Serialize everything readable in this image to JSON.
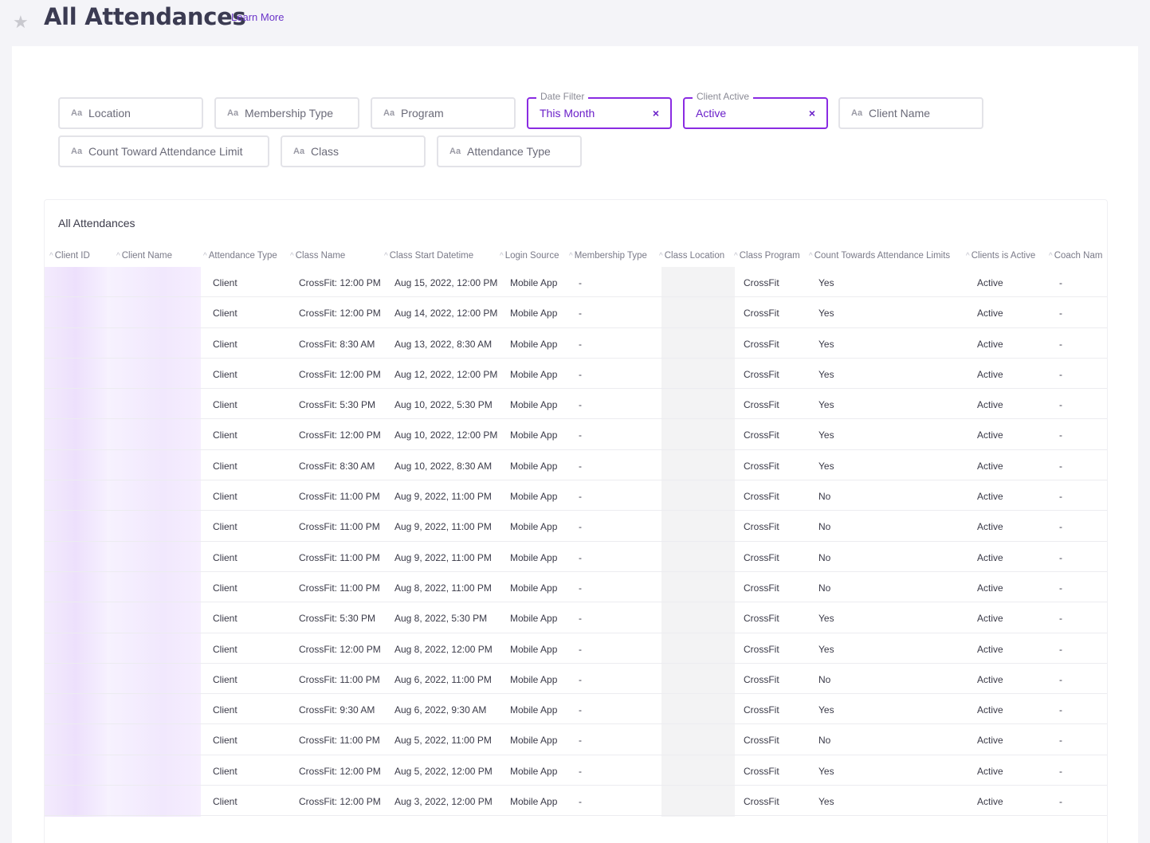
{
  "header": {
    "title": "All Attendances",
    "learn_more": "Learn More",
    "star_icon": "star-icon"
  },
  "filters": {
    "aa_glyph": "Aa",
    "location": "Location",
    "membership_type": "Membership Type",
    "program": "Program",
    "date_filter": {
      "legend": "Date Filter",
      "value": "This Month",
      "clear": "×"
    },
    "client_active": {
      "legend": "Client Active",
      "value": "Active",
      "clear": "×"
    },
    "client_name": "Client Name",
    "count_toward": "Count Toward Attendance Limit",
    "class": "Class",
    "attendance_type": "Attendance Type"
  },
  "table": {
    "title": "All Attendances",
    "caret": "^",
    "columns": [
      "Client ID",
      "Client Name",
      "Attendance Type",
      "Class Name",
      "Class Start Datetime",
      "Login Source",
      "Membership Type",
      "Class Location",
      "Class Program",
      "Count Towards Attendance Limits",
      "Clients is Active",
      "Coach Nam"
    ],
    "rows": [
      {
        "type": "Client",
        "class": "CrossFit: 12:00 PM",
        "start": "Aug 15, 2022, 12:00 PM",
        "source": "Mobile App",
        "membership": "-",
        "program": "CrossFit",
        "counts": "Yes",
        "active": "Active",
        "coach": "-"
      },
      {
        "type": "Client",
        "class": "CrossFit: 12:00 PM",
        "start": "Aug 14, 2022, 12:00 PM",
        "source": "Mobile App",
        "membership": "-",
        "program": "CrossFit",
        "counts": "Yes",
        "active": "Active",
        "coach": "-"
      },
      {
        "type": "Client",
        "class": "CrossFit: 8:30 AM",
        "start": "Aug 13, 2022, 8:30 AM",
        "source": "Mobile App",
        "membership": "-",
        "program": "CrossFit",
        "counts": "Yes",
        "active": "Active",
        "coach": "-"
      },
      {
        "type": "Client",
        "class": "CrossFit: 12:00 PM",
        "start": "Aug 12, 2022, 12:00 PM",
        "source": "Mobile App",
        "membership": "-",
        "program": "CrossFit",
        "counts": "Yes",
        "active": "Active",
        "coach": "-"
      },
      {
        "type": "Client",
        "class": "CrossFit: 5:30 PM",
        "start": "Aug 10, 2022, 5:30 PM",
        "source": "Mobile App",
        "membership": "-",
        "program": "CrossFit",
        "counts": "Yes",
        "active": "Active",
        "coach": "-"
      },
      {
        "type": "Client",
        "class": "CrossFit: 12:00 PM",
        "start": "Aug 10, 2022, 12:00 PM",
        "source": "Mobile App",
        "membership": "-",
        "program": "CrossFit",
        "counts": "Yes",
        "active": "Active",
        "coach": "-"
      },
      {
        "type": "Client",
        "class": "CrossFit: 8:30 AM",
        "start": "Aug 10, 2022, 8:30 AM",
        "source": "Mobile App",
        "membership": "-",
        "program": "CrossFit",
        "counts": "Yes",
        "active": "Active",
        "coach": "-"
      },
      {
        "type": "Client",
        "class": "CrossFit: 11:00 PM",
        "start": "Aug 9, 2022, 11:00 PM",
        "source": "Mobile App",
        "membership": "-",
        "program": "CrossFit",
        "counts": "No",
        "active": "Active",
        "coach": "-"
      },
      {
        "type": "Client",
        "class": "CrossFit: 11:00 PM",
        "start": "Aug 9, 2022, 11:00 PM",
        "source": "Mobile App",
        "membership": "-",
        "program": "CrossFit",
        "counts": "No",
        "active": "Active",
        "coach": "-"
      },
      {
        "type": "Client",
        "class": "CrossFit: 11:00 PM",
        "start": "Aug 9, 2022, 11:00 PM",
        "source": "Mobile App",
        "membership": "-",
        "program": "CrossFit",
        "counts": "No",
        "active": "Active",
        "coach": "-"
      },
      {
        "type": "Client",
        "class": "CrossFit: 11:00 PM",
        "start": "Aug 8, 2022, 11:00 PM",
        "source": "Mobile App",
        "membership": "-",
        "program": "CrossFit",
        "counts": "No",
        "active": "Active",
        "coach": "-"
      },
      {
        "type": "Client",
        "class": "CrossFit: 5:30 PM",
        "start": "Aug 8, 2022, 5:30 PM",
        "source": "Mobile App",
        "membership": "-",
        "program": "CrossFit",
        "counts": "Yes",
        "active": "Active",
        "coach": "-"
      },
      {
        "type": "Client",
        "class": "CrossFit: 12:00 PM",
        "start": "Aug 8, 2022, 12:00 PM",
        "source": "Mobile App",
        "membership": "-",
        "program": "CrossFit",
        "counts": "Yes",
        "active": "Active",
        "coach": "-"
      },
      {
        "type": "Client",
        "class": "CrossFit: 11:00 PM",
        "start": "Aug 6, 2022, 11:00 PM",
        "source": "Mobile App",
        "membership": "-",
        "program": "CrossFit",
        "counts": "No",
        "active": "Active",
        "coach": "-"
      },
      {
        "type": "Client",
        "class": "CrossFit: 9:30 AM",
        "start": "Aug 6, 2022, 9:30 AM",
        "source": "Mobile App",
        "membership": "-",
        "program": "CrossFit",
        "counts": "Yes",
        "active": "Active",
        "coach": "-"
      },
      {
        "type": "Client",
        "class": "CrossFit: 11:00 PM",
        "start": "Aug 5, 2022, 11:00 PM",
        "source": "Mobile App",
        "membership": "-",
        "program": "CrossFit",
        "counts": "No",
        "active": "Active",
        "coach": "-"
      },
      {
        "type": "Client",
        "class": "CrossFit: 12:00 PM",
        "start": "Aug 5, 2022, 12:00 PM",
        "source": "Mobile App",
        "membership": "-",
        "program": "CrossFit",
        "counts": "Yes",
        "active": "Active",
        "coach": "-"
      },
      {
        "type": "Client",
        "class": "CrossFit: 12:00 PM",
        "start": "Aug 3, 2022, 12:00 PM",
        "source": "Mobile App",
        "membership": "-",
        "program": "CrossFit",
        "counts": "Yes",
        "active": "Active",
        "coach": "-"
      }
    ]
  },
  "colors": {
    "accent": "#6a1fc9",
    "active_border": "#8a2be2",
    "page_bg": "#f4f4f8"
  }
}
